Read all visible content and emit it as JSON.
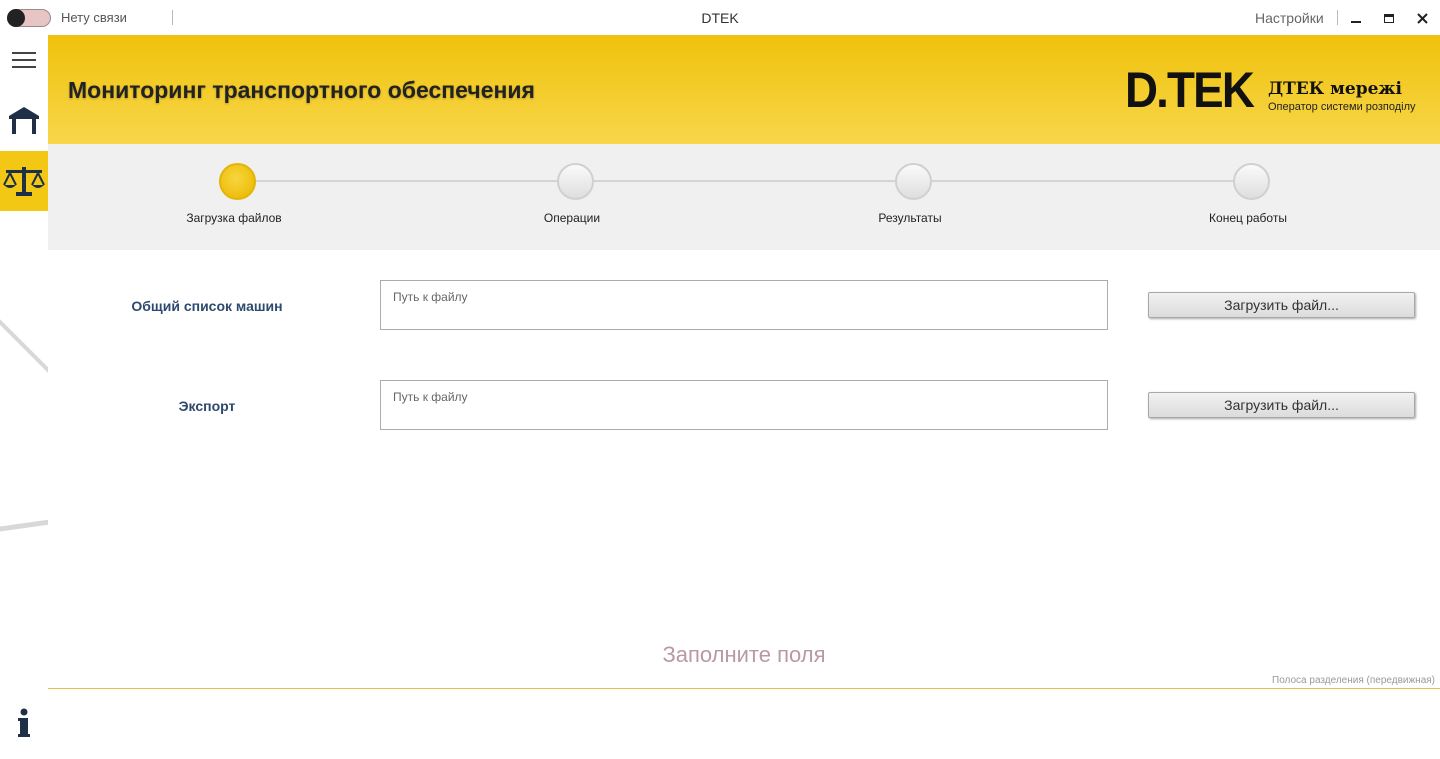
{
  "titlebar": {
    "connection_status": "Нету связи",
    "app_title": "DTEK",
    "settings_label": "Настройки",
    "minimize": "minimize",
    "maximize": "maximize",
    "close": "close"
  },
  "sidebar": {
    "items": [
      {
        "icon": "hamburger-menu-icon"
      },
      {
        "icon": "home-icon"
      },
      {
        "icon": "scales-icon",
        "active": true
      },
      {
        "icon": "info-icon"
      }
    ],
    "active_color": "#f3c814"
  },
  "header": {
    "title": "Мониторинг транспортного обеспечения",
    "brand_name": "ДТЕК мережі",
    "brand_subtitle": "Оператор системи розподілу",
    "logo_text": "D.TEK",
    "colors": {
      "top": "#f0c20c",
      "bottom": "#f7d64a"
    }
  },
  "stepper": {
    "steps": [
      {
        "label": "Загрузка файлов",
        "active": true
      },
      {
        "label": "Операции",
        "active": false
      },
      {
        "label": "Результаты",
        "active": false
      },
      {
        "label": "Конец работы",
        "active": false
      }
    ]
  },
  "form": {
    "rows": [
      {
        "label": "Общий список машин",
        "placeholder": "Путь к файлу",
        "value": "",
        "button_label": "Загрузить файл..."
      },
      {
        "label": "Экспорт",
        "placeholder": "Путь к файлу",
        "value": "",
        "button_label": "Загрузить файл..."
      }
    ]
  },
  "footer": {
    "status_message": "Заполните поля",
    "splitter_hint": "Полоса разделения (передвижная)"
  }
}
